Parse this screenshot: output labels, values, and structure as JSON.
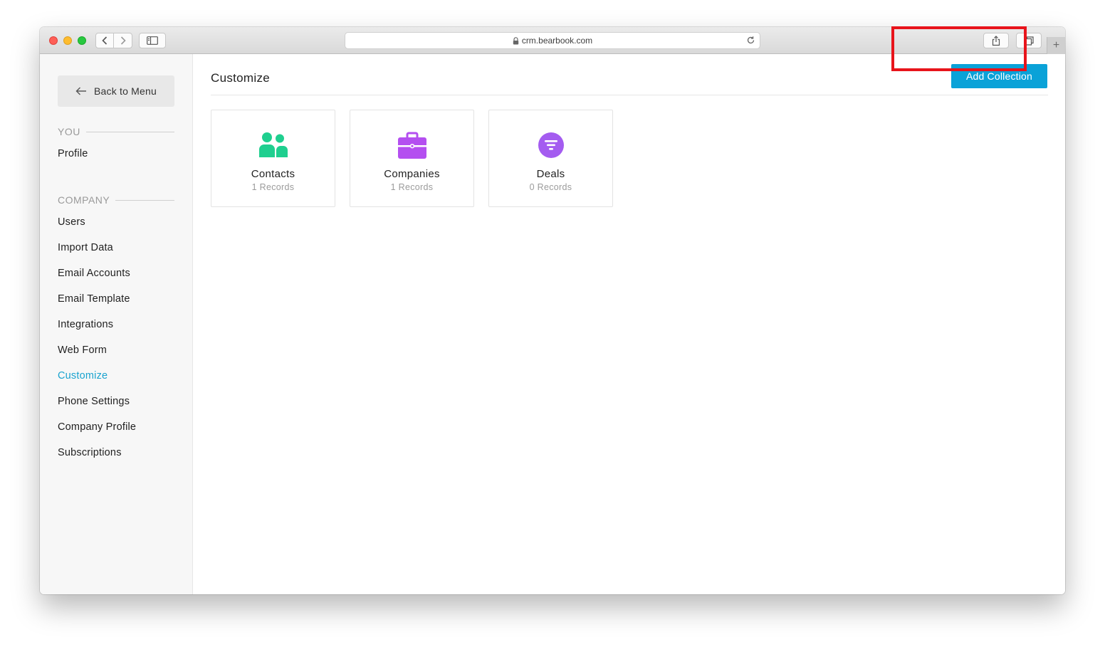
{
  "browser": {
    "url": "crm.bearbook.com",
    "new_tab_label": "+"
  },
  "sidebar": {
    "back_label": "Back to Menu",
    "sections": [
      {
        "title": "YOU",
        "items": [
          {
            "label": "Profile"
          }
        ]
      },
      {
        "title": "COMPANY",
        "items": [
          {
            "label": "Users"
          },
          {
            "label": "Import Data"
          },
          {
            "label": "Email Accounts"
          },
          {
            "label": "Email Template"
          },
          {
            "label": "Integrations"
          },
          {
            "label": "Web Form"
          },
          {
            "label": "Customize",
            "active": true
          },
          {
            "label": "Phone Settings"
          },
          {
            "label": "Company Profile"
          },
          {
            "label": "Subscriptions"
          }
        ]
      }
    ]
  },
  "main": {
    "title": "Customize",
    "add_button_label": "Add Collection",
    "collections": [
      {
        "name": "Contacts",
        "records": "1 Records",
        "icon": "people-icon",
        "color": "#1fcf8f"
      },
      {
        "name": "Companies",
        "records": "1 Records",
        "icon": "briefcase-icon",
        "color": "#b44ff0"
      },
      {
        "name": "Deals",
        "records": "0 Records",
        "icon": "funnel-icon",
        "color": "#a45cf0"
      }
    ]
  },
  "colors": {
    "accent": "#0aa2d8",
    "active_nav": "#1aa3cf",
    "highlight": "#e8141b"
  }
}
